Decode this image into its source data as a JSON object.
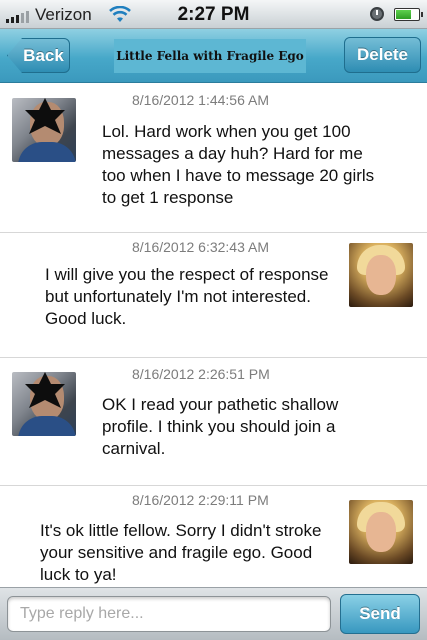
{
  "status_bar": {
    "carrier": "Verizon",
    "time": "2:27 PM",
    "signal_icon": "signal-bars-icon",
    "wifi_icon": "wifi-icon",
    "alarm_icon": "alarm-clock-icon",
    "battery_icon": "battery-icon",
    "battery_level": 0.7
  },
  "nav": {
    "back_label": "Back",
    "title": "Little Fella with Fragile Ego",
    "delete_label": "Delete"
  },
  "messages": [
    {
      "sender": "contact",
      "timestamp": "8/16/2012 1:44:56 AM",
      "text_lines": [
        "Lol. Hard work when you get 100",
        "messages a day huh? Hard for me",
        "too when I have to message 20 girls",
        "to get 1 response"
      ]
    },
    {
      "sender": "me",
      "timestamp": "8/16/2012 6:32:43 AM",
      "text_lines": [
        "I will give you the respect of response",
        "but unfortunately I'm not interested.",
        "Good luck."
      ]
    },
    {
      "sender": "contact",
      "timestamp": "8/16/2012 2:26:51 PM",
      "text_lines": [
        "OK I read your pathetic shallow",
        "profile. I think you should join a",
        "carnival."
      ]
    },
    {
      "sender": "me",
      "timestamp": "8/16/2012 2:29:11 PM",
      "text_lines": [
        "It's ok little fellow. Sorry I didn't stroke",
        "your sensitive and fragile ego. Good",
        "luck to ya!"
      ]
    }
  ],
  "reply": {
    "placeholder": "Type reply here...",
    "value": "",
    "send_label": "Send"
  },
  "colors": {
    "nav_accent": "#47a8c9",
    "button_accent": "#2e8db3",
    "timestamp_gray": "#7c7c7c"
  }
}
